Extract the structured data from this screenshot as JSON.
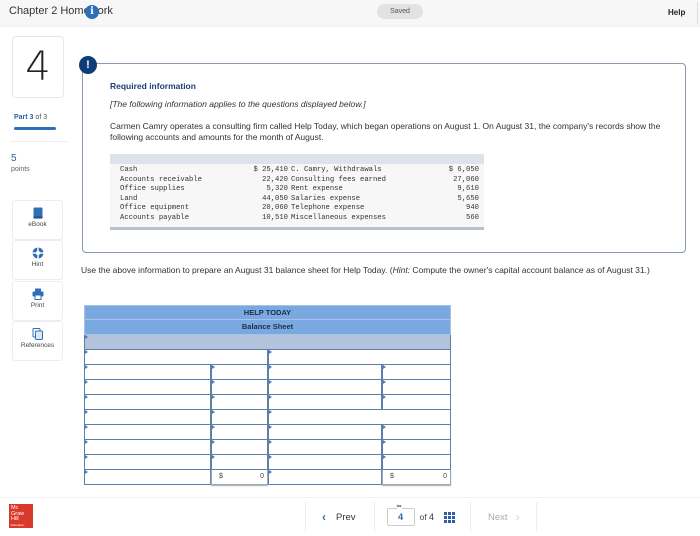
{
  "header": {
    "title": "Chapter 2 Homework",
    "info_icon": "info-icon",
    "saved_label": "Saved",
    "help_label": "Help"
  },
  "question": {
    "number": "4",
    "part_label": "Part 3",
    "part_of": "of 3",
    "part_progress": 1.0,
    "points_value": "5",
    "points_label": "points"
  },
  "tools": [
    {
      "label": "eBook",
      "icon": "book-icon"
    },
    {
      "label": "Hint",
      "icon": "lifebuoy-icon"
    },
    {
      "label": "Print",
      "icon": "printer-icon"
    },
    {
      "label": "References",
      "icon": "documents-icon"
    }
  ],
  "info": {
    "alert_glyph": "!",
    "heading": "Required information",
    "applies": "[The following information applies to the questions displayed below.]",
    "paragraph": "Carmen Camry operates a consulting firm called Help Today, which began operations on August 1. On August 31, the company's records show the following accounts and amounts for the month of August.",
    "accounts": [
      {
        "name1": "Cash",
        "value1": "$ 25,410",
        "name2": "C. Camry, Withdrawals",
        "value2": "$ 6,050"
      },
      {
        "name1": "Accounts receivable",
        "value1": "22,420",
        "name2": "Consulting fees earned",
        "value2": "27,060"
      },
      {
        "name1": "Office supplies",
        "value1": "5,320",
        "name2": "Rent expense",
        "value2": "9,610"
      },
      {
        "name1": "Land",
        "value1": "44,050",
        "name2": "Salaries expense",
        "value2": "5,650"
      },
      {
        "name1": "Office equipment",
        "value1": "20,060",
        "name2": "Telephone expense",
        "value2": "940"
      },
      {
        "name1": "Accounts payable",
        "value1": "10,510",
        "name2": "Miscellaneous expenses",
        "value2": "560"
      }
    ]
  },
  "instructions": {
    "before_hint": "Use the above information to prepare an August 31 balance sheet for Help Today. (",
    "hint_label": "Hint:",
    "after_hint": " Compute the owner's capital account balance as of August 31.)"
  },
  "balance_sheet": {
    "company": "HELP TODAY",
    "title": "Balance Sheet",
    "left_total_currency": "$",
    "left_total_value": "0",
    "right_total_currency": "$",
    "right_total_value": "0"
  },
  "footer": {
    "logo_lines": [
      "Mc",
      "Graw",
      "Hill",
      "Education"
    ],
    "prev_label": "Prev",
    "current_page": "4",
    "of_label": "of",
    "total_pages": "4",
    "next_label": "Next"
  }
}
